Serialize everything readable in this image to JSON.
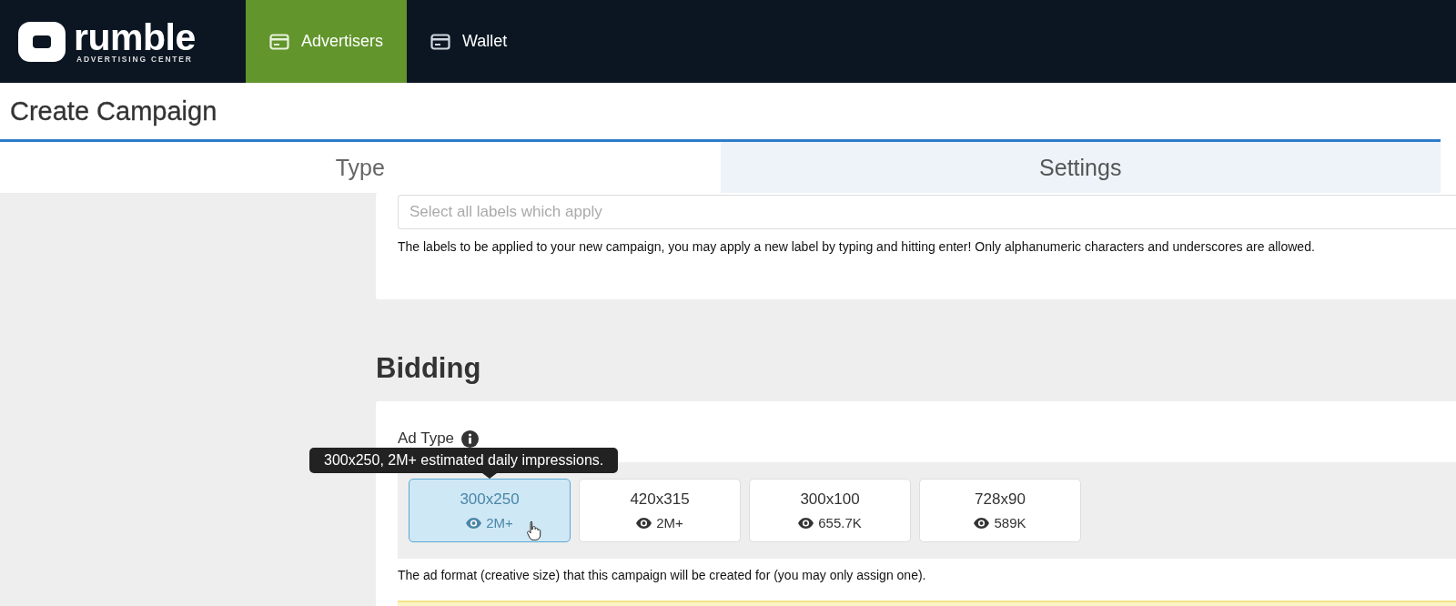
{
  "nav": {
    "logo": {
      "wordmark": "rumble",
      "tagline": "ADVERTISING CENTER"
    },
    "items": [
      {
        "label": "Advertisers",
        "selected": true
      },
      {
        "label": "Wallet",
        "selected": false
      }
    ]
  },
  "page_title": "Create Campaign",
  "steps": [
    {
      "label": "Type",
      "selected": false
    },
    {
      "label": "Settings",
      "selected": true
    }
  ],
  "labels": {
    "placeholder": "Select all labels which apply",
    "help": "The labels to be applied to your new campaign, you may apply a new label by typing and hitting enter! Only alphanumeric characters and underscores are allowed."
  },
  "bidding": {
    "heading": "Bidding",
    "ad_type": {
      "label": "Ad Type",
      "tooltip": "300x250, 2M+ estimated daily impressions.",
      "options": [
        {
          "size": "300x250",
          "impressions": "2M+",
          "selected": true
        },
        {
          "size": "420x315",
          "impressions": "2M+",
          "selected": false
        },
        {
          "size": "300x100",
          "impressions": "655.7K",
          "selected": false
        },
        {
          "size": "728x90",
          "impressions": "589K",
          "selected": false
        }
      ],
      "help": "The ad format (creative size) that this campaign will be created for (you may only assign one)."
    }
  }
}
